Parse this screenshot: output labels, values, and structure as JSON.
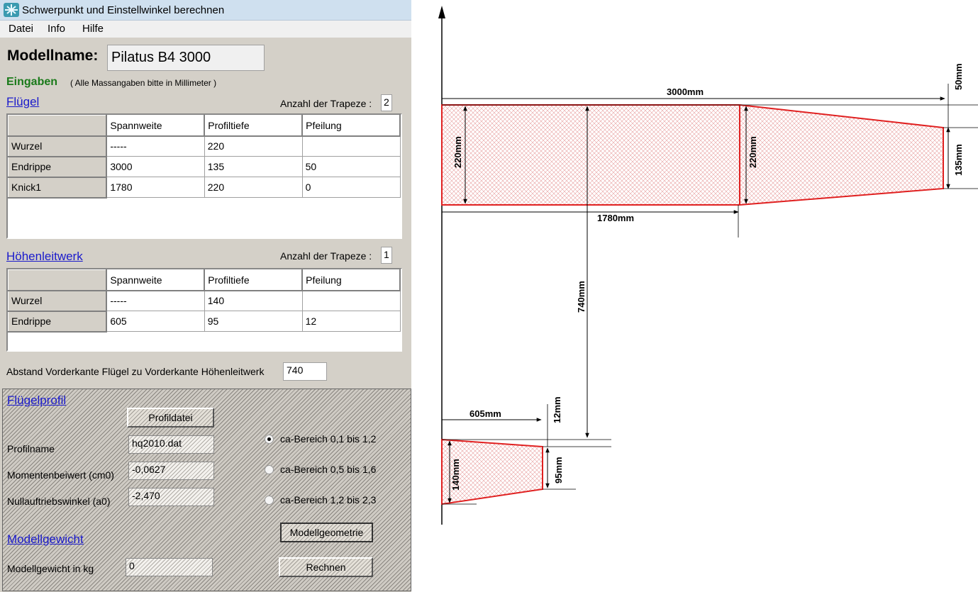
{
  "window": {
    "title": "Schwerpunkt und Einstellwinkel berechnen"
  },
  "menu": [
    "Datei",
    "Info",
    "Hilfe"
  ],
  "model": {
    "name_label": "Modellname:",
    "name_value": "Pilatus B4 3000"
  },
  "inputs": {
    "heading": "Eingaben",
    "note": "( Alle Massangaben bitte in Millimeter )"
  },
  "wing": {
    "link": "Flügel",
    "trapeze_label": "Anzahl der Trapeze :",
    "trapeze_value": "2",
    "columns": [
      "Spannweite",
      "Profiltiefe",
      "Pfeilung"
    ],
    "rows": [
      {
        "label": "Wurzel",
        "cells": [
          "-----",
          "220",
          ""
        ]
      },
      {
        "label": "Endrippe",
        "cells": [
          "3000",
          "135",
          "50"
        ]
      },
      {
        "label": "Knick1",
        "cells": [
          "1780",
          "220",
          "0"
        ]
      }
    ]
  },
  "tail": {
    "link": "Höhenleitwerk",
    "trapeze_label": "Anzahl der Trapeze :",
    "trapeze_value": "1",
    "columns": [
      "Spannweite",
      "Profiltiefe",
      "Pfeilung"
    ],
    "rows": [
      {
        "label": "Wurzel",
        "cells": [
          "-----",
          "140",
          ""
        ]
      },
      {
        "label": "Endrippe",
        "cells": [
          "605",
          "95",
          "12"
        ]
      }
    ]
  },
  "distance": {
    "label": "Abstand Vorderkante Flügel zu Vorderkante Höhenleitwerk",
    "value": "740"
  },
  "profile": {
    "link": "Flügelprofil",
    "file_button": "Profildatei",
    "name_label": "Profilname",
    "name_value": "hq2010.dat",
    "cm0_label": "Momentenbeiwert (cm0)",
    "cm0_value": "-0,0627",
    "a0_label": "Nullauftriebswinkel (a0)",
    "a0_value": "-2,470",
    "ranges": [
      {
        "label": "ca-Bereich  0,1 bis 1,2",
        "selected": true
      },
      {
        "label": "ca-Bereich  0,5 bis 1,6",
        "selected": false
      },
      {
        "label": "ca-Bereich  1,2 bis 2,3",
        "selected": false
      }
    ],
    "geometry_button": "Modellgeometrie"
  },
  "weight": {
    "link": "Modellgewicht",
    "label": "Modellgewicht in kg",
    "value": "0",
    "calc_button": "Rechnen"
  },
  "drawing": {
    "dims": {
      "span": "3000mm",
      "root_wing": "220mm",
      "knick_depth": "220mm",
      "tip_sweep": "50mm",
      "tip_depth": "135mm",
      "knick_span": "1780mm",
      "distance": "740mm",
      "tail_span": "605mm",
      "tail_sweep": "12mm",
      "tail_root": "140mm",
      "tail_tip": "95mm"
    },
    "colors": {
      "outline": "#e02020",
      "hatch": "#e8a0a0"
    }
  }
}
